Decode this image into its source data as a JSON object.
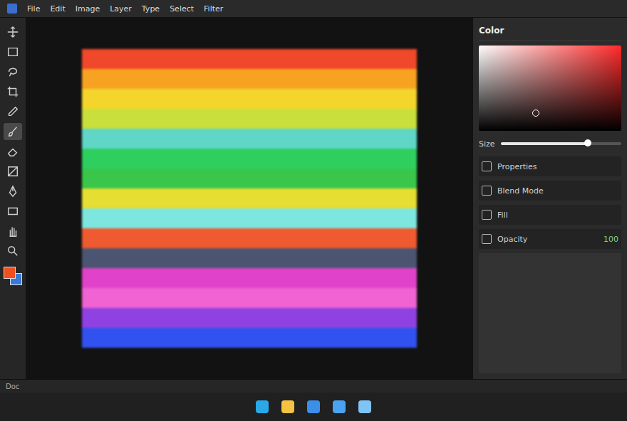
{
  "menu": [
    "File",
    "Edit",
    "Image",
    "Layer",
    "Type",
    "Select",
    "Filter"
  ],
  "tools": [
    {
      "kind": "move",
      "selected": false
    },
    {
      "kind": "marquee",
      "selected": false
    },
    {
      "kind": "lasso",
      "selected": false
    },
    {
      "kind": "crop",
      "selected": false
    },
    {
      "kind": "eyedropper",
      "selected": false
    },
    {
      "kind": "brush",
      "selected": true
    },
    {
      "kind": "eraser",
      "selected": false
    },
    {
      "kind": "gradient",
      "selected": false
    },
    {
      "kind": "pen",
      "selected": false
    },
    {
      "kind": "shape",
      "selected": false
    },
    {
      "kind": "hand",
      "selected": false
    },
    {
      "kind": "zoom",
      "selected": false
    }
  ],
  "swatches": {
    "foreground": "#f05020",
    "background": "#3a78d8"
  },
  "canvas": {
    "bands": [
      {
        "color": "#f0482a"
      },
      {
        "color": "#f7a321"
      },
      {
        "color": "#f3d52b"
      },
      {
        "color": "#c9df3c"
      },
      {
        "color": "#5fd6c6"
      },
      {
        "color": "#2ecf5e"
      },
      {
        "color": "#39c64b"
      },
      {
        "color": "#e6de32"
      },
      {
        "color": "#7de7df"
      },
      {
        "color": "#ef5a31"
      },
      {
        "color": "#4b5571"
      },
      {
        "color": "#e043c9"
      },
      {
        "color": "#f162d2"
      },
      {
        "color": "#8f42e1"
      },
      {
        "color": "#3152ef"
      }
    ]
  },
  "panel": {
    "title": "Color",
    "slider": {
      "label": "Size",
      "level": 0.72
    },
    "rows": [
      {
        "label": "Properties",
        "reading": ""
      },
      {
        "label": "Blend Mode",
        "reading": ""
      },
      {
        "label": "Fill",
        "reading": ""
      },
      {
        "label": "Opacity",
        "reading": "100"
      }
    ]
  },
  "status": "Doc",
  "taskbar": [
    {
      "kind": "edge"
    },
    {
      "kind": "files"
    },
    {
      "kind": "store"
    },
    {
      "kind": "windows"
    },
    {
      "kind": "photos"
    }
  ]
}
